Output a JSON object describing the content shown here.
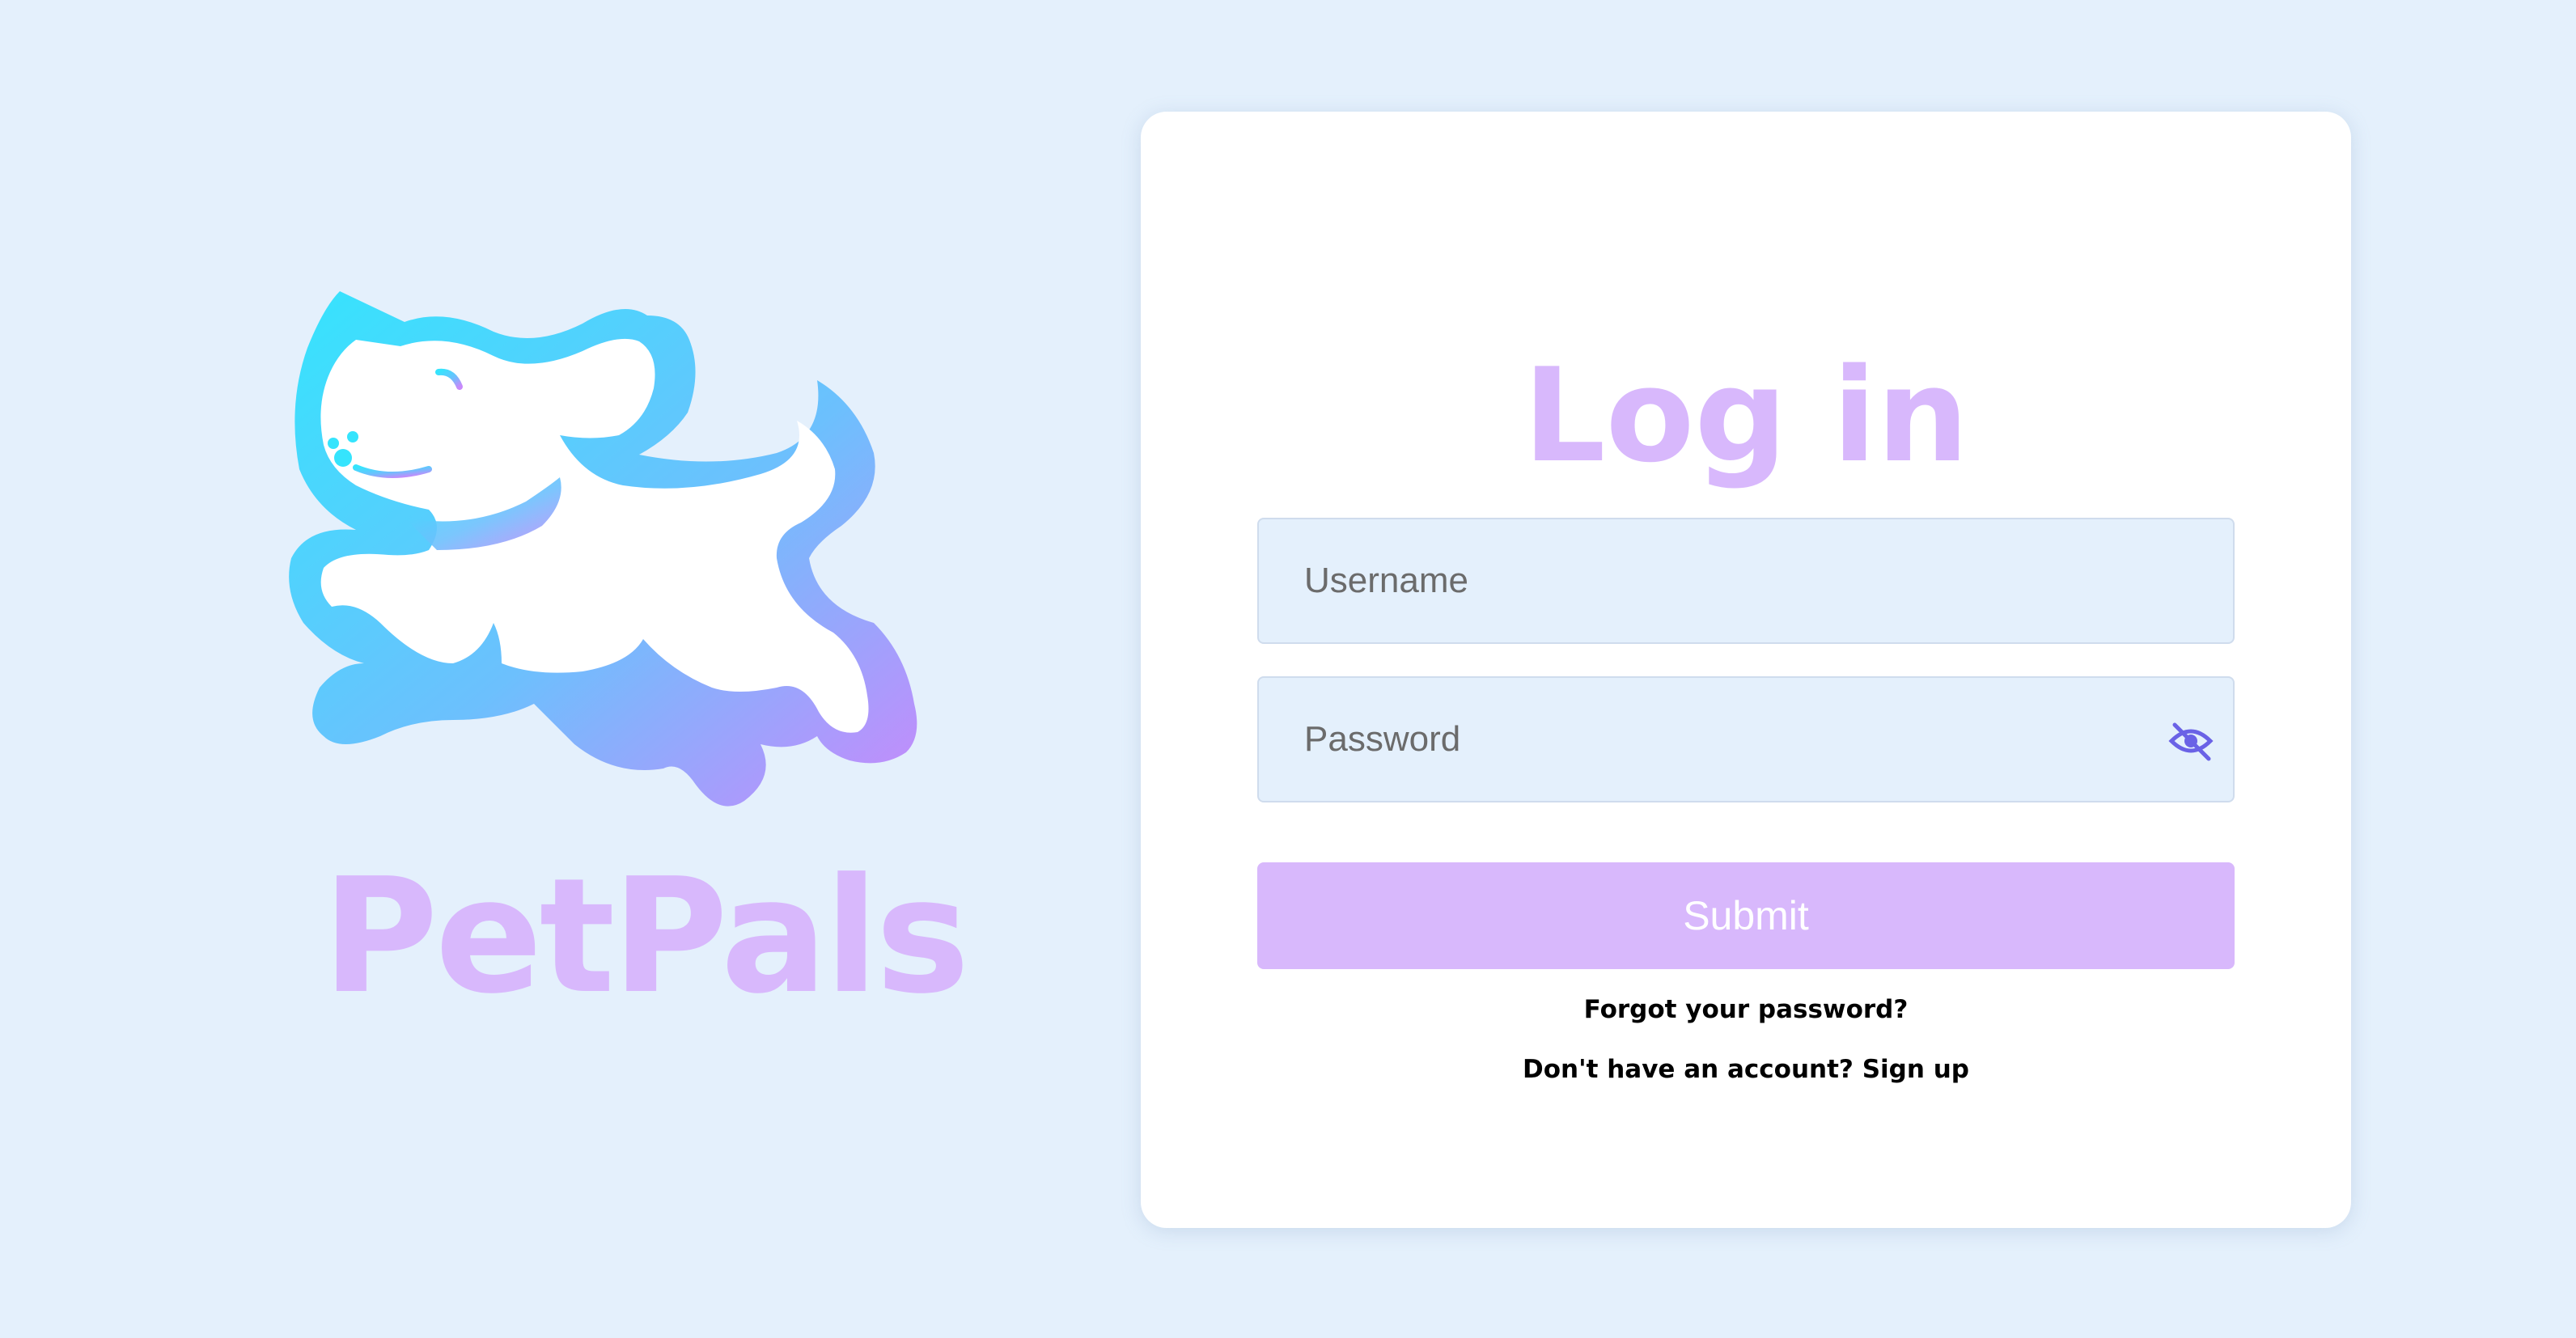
{
  "brand": {
    "name": "PetPals",
    "logo_icon": "running-dog-icon",
    "gradient_start": "#35e4fd",
    "gradient_end": "#c889fb",
    "name_color": "#d8b8fc"
  },
  "login": {
    "title": "Log in",
    "username_placeholder": "Username",
    "username_value": "",
    "password_placeholder": "Password",
    "password_value": "",
    "password_toggle_icon": "eye-slash-icon",
    "submit_label": "Submit",
    "forgot_label": "Forgot your password?",
    "signup_label": "Don't have an account? Sign up"
  },
  "colors": {
    "background": "#e4f0fc",
    "accent": "#d8b8fc",
    "icon": "#6a62e6"
  }
}
